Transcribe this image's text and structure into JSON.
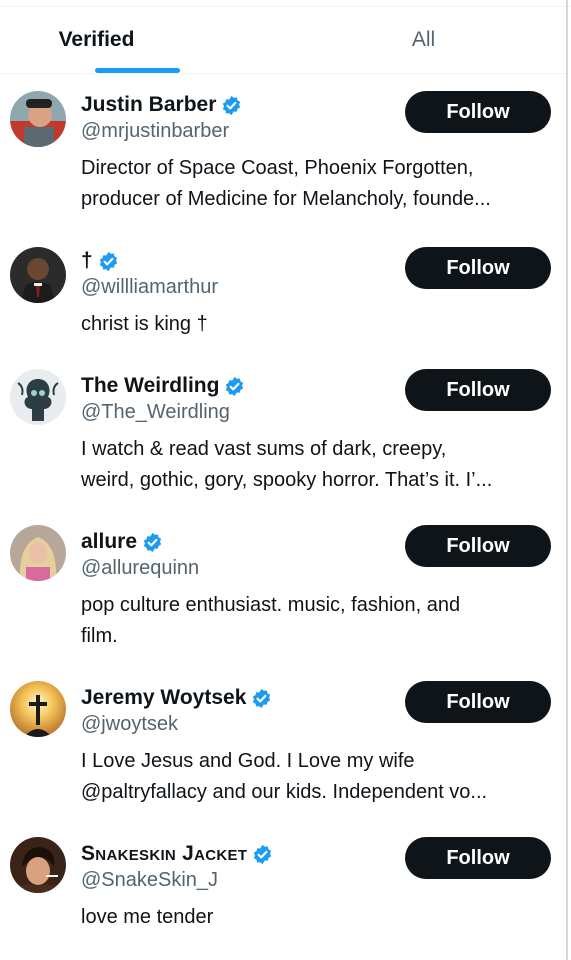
{
  "tabs": [
    {
      "label": "Verified",
      "active": true
    },
    {
      "label": "All",
      "active": false
    }
  ],
  "colors": {
    "accent": "#1d9bf0",
    "follow_bg": "#0f1419",
    "secondary_text": "#536471"
  },
  "users": [
    {
      "name": "Justin Barber",
      "verified": true,
      "handle": "@mrjustinbarber",
      "bio_lines": [
        "Director of Space Coast, Phoenix Forgotten,",
        "producer of Medicine for Melancholy, founde..."
      ],
      "button": "Follow"
    },
    {
      "name": "†",
      "verified": true,
      "handle": "@willliamarthur",
      "bio_lines": [
        "christ is king †"
      ],
      "button": "Follow"
    },
    {
      "name": "The Weirdling",
      "verified": true,
      "handle": "@The_Weirdling",
      "bio_lines": [
        "I watch & read vast sums of dark, creepy,",
        "weird, gothic, gory, spooky horror. That’s it. I’..."
      ],
      "button": "Follow"
    },
    {
      "name": "allure",
      "verified": true,
      "handle": "@allurequinn",
      "bio_lines": [
        "pop culture enthusiast. music, fashion, and",
        "film."
      ],
      "button": "Follow"
    },
    {
      "name": "Jeremy Woytsek",
      "verified": true,
      "handle": "@jwoytsek",
      "bio_lines": [
        "I Love Jesus and God. I Love my wife",
        "@paltryfallacy and our kids. Independent vo..."
      ],
      "button": "Follow"
    },
    {
      "name": "Snakeskin Jacket",
      "verified": true,
      "handle": "@SnakeSkin_J",
      "bio_lines": [
        "love me tender"
      ],
      "button": "Follow"
    }
  ]
}
